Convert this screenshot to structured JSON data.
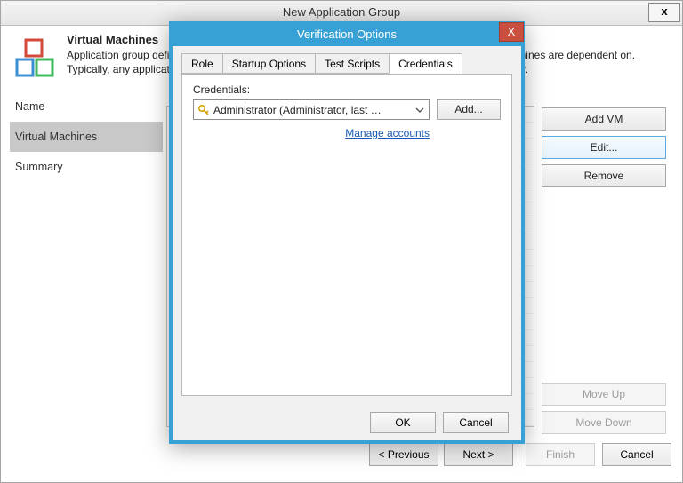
{
  "parent": {
    "title": "New Application Group",
    "close_glyph": "x",
    "heading": "Virtual Machines",
    "desc_line1": "Application group defines virtual machines running production applications that other virtual machines are dependent on.",
    "desc_line2": "Typically, any application group contains at least domain controller, DNS server and DHCP server.",
    "nav": {
      "items": [
        "Name",
        "Virtual Machines",
        "Summary"
      ],
      "selected_index": 1
    },
    "side_buttons": {
      "add": "Add VM",
      "edit": "Edit...",
      "remove": "Remove",
      "move_up": "Move Up",
      "move_down": "Move Down"
    },
    "wizard": {
      "prev": "< Previous",
      "next": "Next >",
      "finish": "Finish",
      "cancel": "Cancel"
    }
  },
  "modal": {
    "title": "Verification Options",
    "close_glyph": "X",
    "tabs": [
      "Role",
      "Startup Options",
      "Test Scripts",
      "Credentials"
    ],
    "active_tab": 3,
    "credentials": {
      "label": "Credentials:",
      "selected": "Administrator (Administrator, last edited: ",
      "add_label": "Add...",
      "manage_link": "Manage accounts"
    },
    "footer": {
      "ok": "OK",
      "cancel": "Cancel"
    }
  }
}
